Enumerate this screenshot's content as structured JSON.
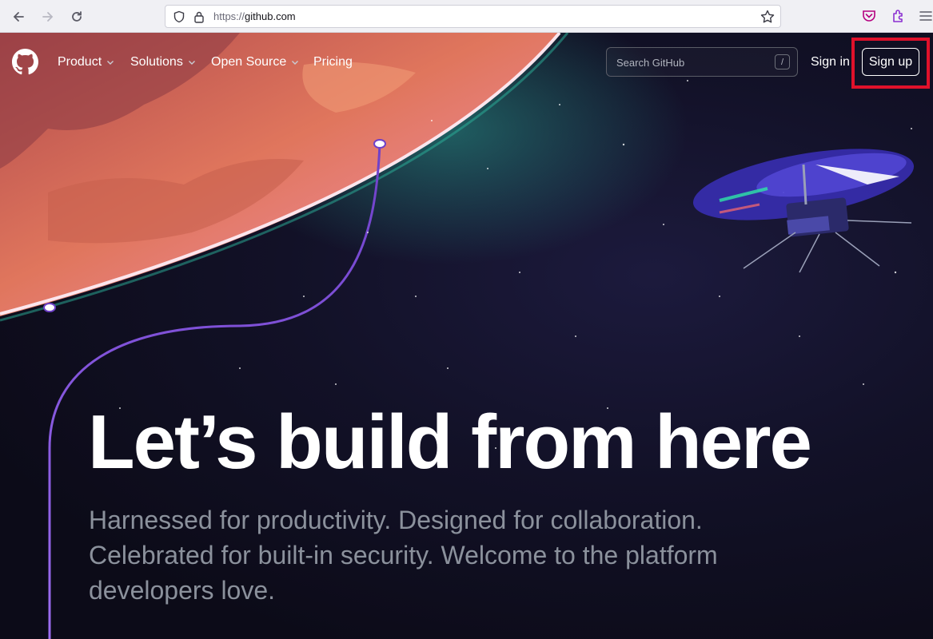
{
  "browser": {
    "url_protocol": "https://",
    "url_host": "github.com"
  },
  "header": {
    "nav": [
      {
        "label": "Product",
        "has_dropdown": true
      },
      {
        "label": "Solutions",
        "has_dropdown": true
      },
      {
        "label": "Open Source",
        "has_dropdown": true
      },
      {
        "label": "Pricing",
        "has_dropdown": false
      }
    ],
    "search_placeholder": "Search GitHub",
    "search_shortcut": "/",
    "signin_label": "Sign in",
    "signup_label": "Sign up"
  },
  "hero": {
    "title": "Let’s build from here",
    "subtitle": "Harnessed for productivity. Designed for collaboration. Celebrated for built-in security. Welcome to the platform developers love."
  },
  "colors": {
    "highlight": "#e0112b",
    "planet": "#e0765d",
    "path_line": "#6e40c9"
  },
  "icons": [
    "back-arrow-icon",
    "forward-arrow-icon",
    "reload-icon",
    "shield-icon",
    "lock-icon",
    "star-icon",
    "pocket-icon",
    "extensions-icon",
    "menu-icon",
    "github-logo-icon",
    "chevron-down-icon"
  ]
}
